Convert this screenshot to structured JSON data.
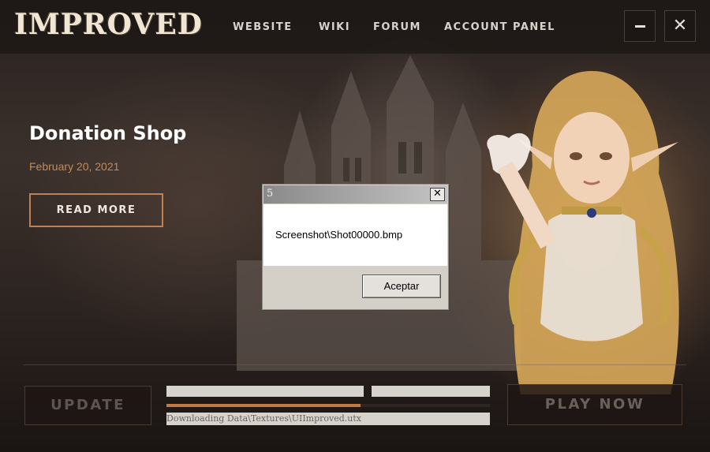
{
  "app": {
    "logo": "IMPROVED"
  },
  "nav": {
    "items": [
      "WEBSITE",
      "WIKI",
      "FORUM",
      "ACCOUNT PANEL"
    ]
  },
  "window_controls": {
    "minimize_icon": "minimize-icon",
    "close_icon": "close-icon",
    "close_glyph": "✕"
  },
  "news": {
    "title": "Donation Shop",
    "date": "February 20, 2021",
    "read_more_label": "READ MORE"
  },
  "launcher": {
    "update_label": "UPDATE",
    "play_label": "PLAY NOW",
    "progress": 0.6,
    "status_text": "Downloading Data\\Textures\\UIImproved.utx"
  },
  "dialog": {
    "title": "5",
    "message": "Screenshot\\Shot00000.bmp",
    "ok_label": "Aceptar",
    "close_glyph": "✕"
  },
  "colors": {
    "accent": "#c17c45",
    "date": "#c48b55"
  }
}
